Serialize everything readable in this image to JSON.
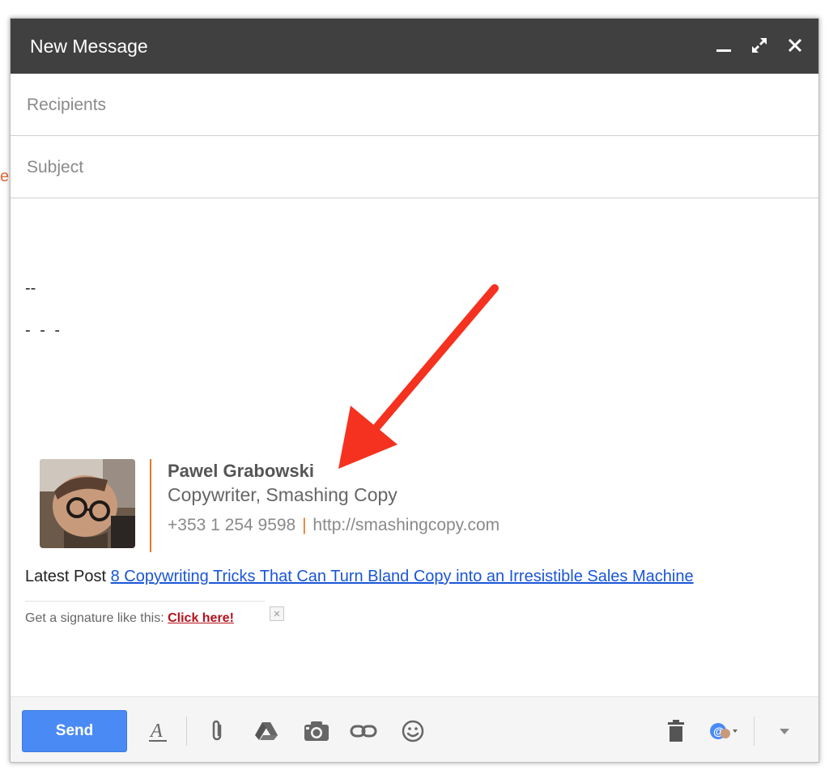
{
  "window": {
    "title": "New Message"
  },
  "compose": {
    "recipients_placeholder": "Recipients",
    "subject_placeholder": "Subject",
    "body_line1": "--",
    "body_line2": "- - -"
  },
  "signature": {
    "name": "Pawel Grabowski",
    "role": "Copywriter, Smashing Copy",
    "phone": "+353 1 254 9598",
    "separator": "|",
    "website": "http://smashingcopy.com",
    "accent_color": "#e07b26"
  },
  "latest_post": {
    "prefix": "Latest Post",
    "link_text": "8 Copywriting Tricks That Can Turn Bland Copy into an Irresistible Sales Machine"
  },
  "promo": {
    "text": "Get a signature like this:",
    "link_text": "Click here!"
  },
  "toolbar": {
    "send_label": "Send",
    "send_color": "#4a8af4",
    "icons": [
      "formatting-icon",
      "attach-icon",
      "drive-icon",
      "photo-icon",
      "link-icon",
      "emoji-icon",
      "trash-icon",
      "signature-avatar-icon",
      "more-options-icon"
    ]
  },
  "annotation": {
    "arrow_color": "#f5311f"
  },
  "colors": {
    "titlebar": "#404040",
    "link": "#1a56d6",
    "promo_link": "#b3121b"
  }
}
